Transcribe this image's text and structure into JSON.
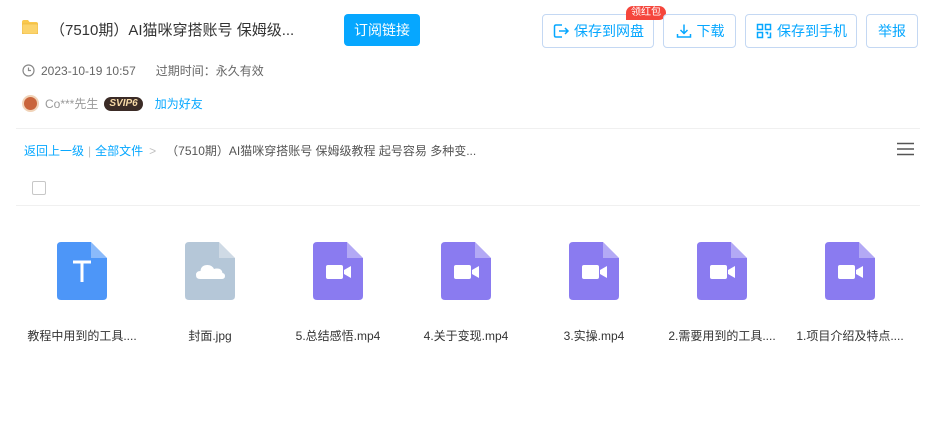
{
  "header": {
    "title": "（7510期）AI猫咪穿搭账号 保姆级...",
    "subscribe_label": "订阅链接",
    "save_label": "保存到网盘",
    "hongbao_badge": "领红包",
    "download_label": "下载",
    "save_phone_label": "保存到手机",
    "report_label": "举报"
  },
  "meta": {
    "date": "2023-10-19 10:57",
    "expire": "过期时间：永久有效"
  },
  "user": {
    "name": "Co***先生",
    "vip_badge": "SVIP6",
    "add_friend": "加为好友"
  },
  "breadcrumb": {
    "back": "返回上一级",
    "sep": "|",
    "all_files": "全部文件",
    "arrow": ">",
    "current": "（7510期）AI猫咪穿搭账号 保姆级教程 起号容易 多种变..."
  },
  "files": [
    {
      "name": "教程中用到的工具....",
      "type": "text-doc-icon",
      "color": "#4d96f8"
    },
    {
      "name": "封面.jpg",
      "type": "image-cloud-icon",
      "color": "#b5c7d8"
    },
    {
      "name": "5.总结感悟.mp4",
      "type": "video-icon",
      "color": "#8a7bf0"
    },
    {
      "name": "4.关于变现.mp4",
      "type": "video-icon",
      "color": "#8a7bf0"
    },
    {
      "name": "3.实操.mp4",
      "type": "video-icon",
      "color": "#8a7bf0"
    },
    {
      "name": "2.需要用到的工具....",
      "type": "video-icon",
      "color": "#8a7bf0"
    },
    {
      "name": "1.项目介绍及特点....",
      "type": "video-icon",
      "color": "#8a7bf0"
    }
  ],
  "colors": {
    "accent": "#06a7ff",
    "badge_red": "#f5463c"
  }
}
